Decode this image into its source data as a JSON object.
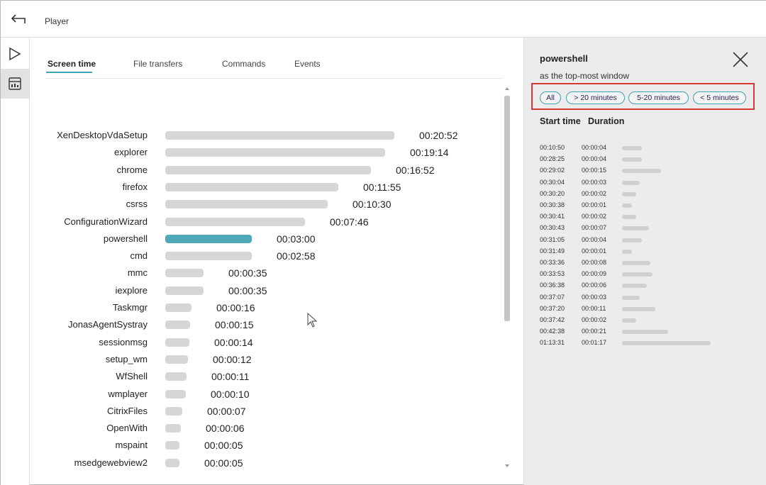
{
  "header": {
    "title": "Player"
  },
  "tabs": [
    {
      "label": "Screen time"
    },
    {
      "label": "File transfers"
    },
    {
      "label": "Commands"
    },
    {
      "label": "Events"
    }
  ],
  "chart_data": {
    "type": "bar",
    "unit": "duration (hh:mm:ss)",
    "highlighted": "powershell",
    "colors": {
      "default": "#d6d6d6",
      "highlight": "#4ea9b8"
    },
    "categories": [
      "XenDesktopVdaSetup",
      "explorer",
      "chrome",
      "firefox",
      "csrss",
      "ConfigurationWizard",
      "powershell",
      "cmd",
      "mmc",
      "iexplore",
      "Taskmgr",
      "JonasAgentSystray",
      "sessionmsg",
      "setup_wm",
      "WfShell",
      "wmplayer",
      "CitrixFiles",
      "OpenWith",
      "mspaint",
      "msedgewebview2"
    ],
    "labels": [
      "00:20:52",
      "00:19:14",
      "00:16:52",
      "00:11:55",
      "00:10:30",
      "00:07:46",
      "00:03:00",
      "00:02:58",
      "00:00:35",
      "00:00:35",
      "00:00:16",
      "00:00:15",
      "00:00:14",
      "00:00:12",
      "00:00:11",
      "00:00:10",
      "00:00:07",
      "00:00:06",
      "00:00:05",
      "00:00:05"
    ],
    "values_seconds": [
      1252,
      1154,
      1012,
      715,
      630,
      466,
      180,
      178,
      35,
      35,
      16,
      15,
      14,
      12,
      11,
      10,
      7,
      6,
      5,
      5
    ]
  },
  "panel": {
    "title": "powershell",
    "subtitle": "as the top-most window",
    "filters": [
      "All",
      "> 20 minutes",
      "5-20 minutes",
      "< 5 minutes"
    ],
    "columns": [
      "Start time",
      "Duration"
    ],
    "sessions": [
      {
        "start": "00:10:50",
        "duration": "00:00:04",
        "seconds": 4
      },
      {
        "start": "00:28:25",
        "duration": "00:00:04",
        "seconds": 4
      },
      {
        "start": "00:29:02",
        "duration": "00:00:15",
        "seconds": 15
      },
      {
        "start": "00:30:04",
        "duration": "00:00:03",
        "seconds": 3
      },
      {
        "start": "00:30:20",
        "duration": "00:00:02",
        "seconds": 2
      },
      {
        "start": "00:30:38",
        "duration": "00:00:01",
        "seconds": 1
      },
      {
        "start": "00:30:41",
        "duration": "00:00:02",
        "seconds": 2
      },
      {
        "start": "00:30:43",
        "duration": "00:00:07",
        "seconds": 7
      },
      {
        "start": "00:31:05",
        "duration": "00:00:04",
        "seconds": 4
      },
      {
        "start": "00:31:49",
        "duration": "00:00:01",
        "seconds": 1
      },
      {
        "start": "00:33:36",
        "duration": "00:00:08",
        "seconds": 8
      },
      {
        "start": "00:33:53",
        "duration": "00:00:09",
        "seconds": 9
      },
      {
        "start": "00:36:38",
        "duration": "00:00:06",
        "seconds": 6
      },
      {
        "start": "00:37:07",
        "duration": "00:00:03",
        "seconds": 3
      },
      {
        "start": "00:37:20",
        "duration": "00:00:11",
        "seconds": 11
      },
      {
        "start": "00:37:42",
        "duration": "00:00:02",
        "seconds": 2
      },
      {
        "start": "00:42:38",
        "duration": "00:00:21",
        "seconds": 21
      },
      {
        "start": "01:13:31",
        "duration": "00:01:17",
        "seconds": 77
      }
    ]
  }
}
